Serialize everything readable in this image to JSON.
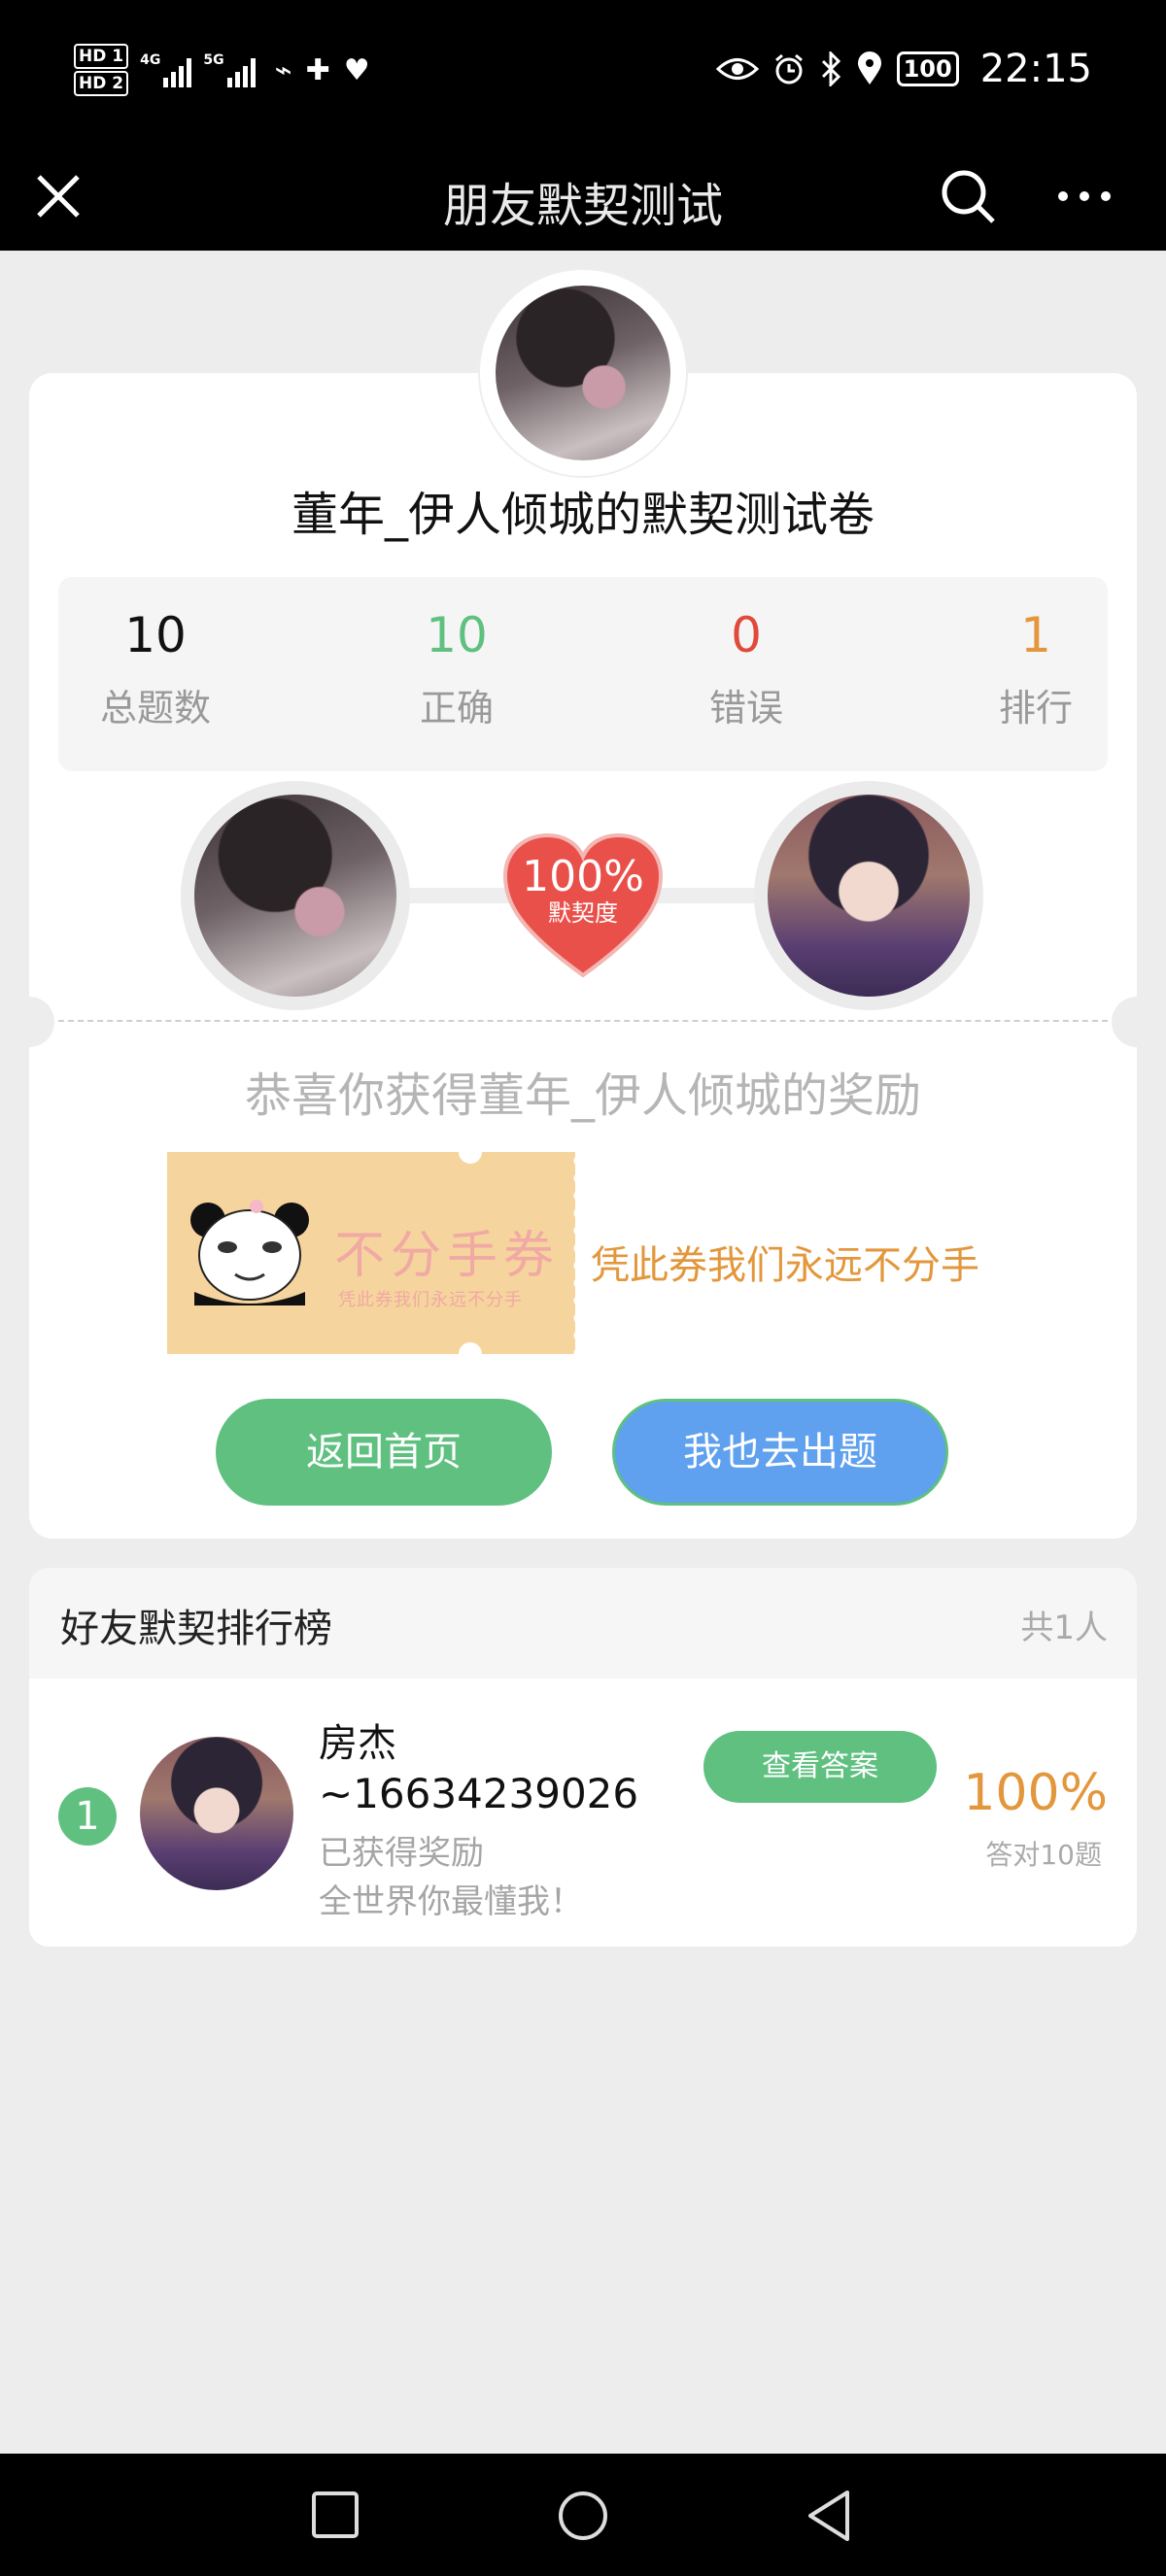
{
  "status_bar": {
    "hd1": "HD 1",
    "hd2": "HD 2",
    "sig1": "4G",
    "sig2": "5G",
    "battery": "100",
    "time": "22:15"
  },
  "nav": {
    "title": "朋友默契测试"
  },
  "quiz": {
    "title": "董年_伊人倾城的默契测试卷",
    "stats": [
      {
        "value": "10",
        "label": "总题数",
        "color": "#111111"
      },
      {
        "value": "10",
        "label": "正确",
        "color": "#5fc080"
      },
      {
        "value": "0",
        "label": "错误",
        "color": "#e04a3a"
      },
      {
        "value": "1",
        "label": "排行",
        "color": "#e3973c"
      }
    ],
    "match_percent": "100%",
    "match_label": "默契度"
  },
  "reward": {
    "title": "恭喜你获得董年_伊人倾城的奖励",
    "coupon_title": "不分手券",
    "coupon_sub": "凭此券我们永远不分手",
    "description": "凭此券我们永远不分手"
  },
  "buttons": {
    "home": "返回首页",
    "create": "我也去出题"
  },
  "leaderboard": {
    "title": "好友默契排行榜",
    "count": "共1人",
    "entries": [
      {
        "rank": "1",
        "name_line1": "房杰",
        "name_line2": "~16634239026",
        "reward_status": "已获得奖励",
        "message": "全世界你最懂我！",
        "answer_button": "查看答案",
        "percent": "100%",
        "correct_text": "答对10题"
      }
    ]
  },
  "colors": {
    "green": "#5fc080",
    "blue": "#5fa0ef",
    "orange": "#e3973c",
    "red": "#e04a3a"
  }
}
